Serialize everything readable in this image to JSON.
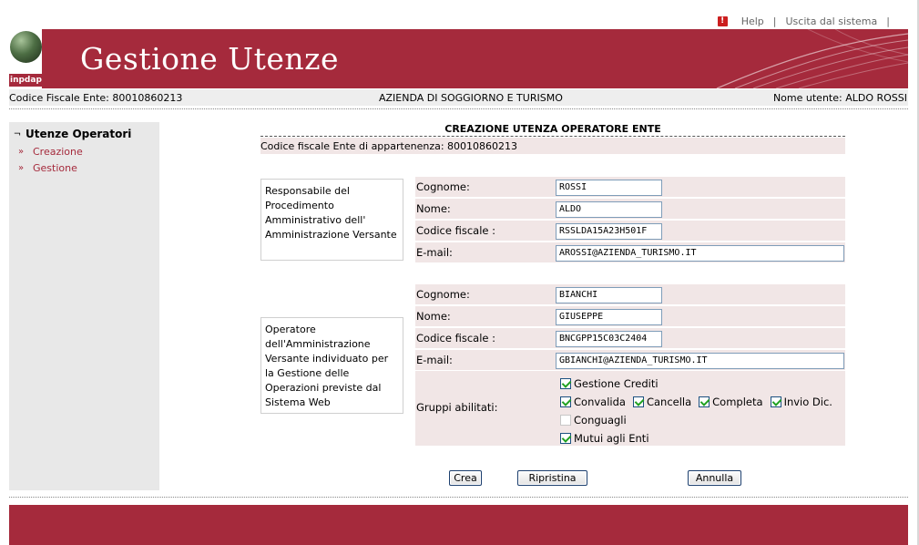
{
  "header": {
    "help_label": "Help",
    "exit_label": "Uscita dal sistema",
    "separator": "|",
    "help_icon": "!",
    "title": "Gestione Utenze",
    "logo_text": "inpdap",
    "brand_color": "#a52a3c"
  },
  "info_bar": {
    "codice_fiscale_ente": "Codice Fiscale Ente:  80010860213",
    "ente_name": "AZIENDA DI SOGGIORNO E TURISMO",
    "user": "Nome utente: ALDO ROSSI"
  },
  "sidebar": {
    "title": "Utenze Operatori",
    "title_bullet": "¬",
    "item_bullet": "»",
    "items": [
      {
        "label": "Creazione"
      },
      {
        "label": "Gestione"
      }
    ]
  },
  "form": {
    "title": "CREAZIONE UTENZA OPERATORE ENTE",
    "ente_row": "Codice fiscale Ente di appartenenza: 80010860213",
    "responsabile": {
      "description": "Responsabile del Procedimento Amministrativo dell' Amministrazione Versante",
      "cognome_label": "Cognome:",
      "cognome_value": "ROSSI",
      "nome_label": "Nome:",
      "nome_value": "ALDO",
      "cf_label": "Codice fiscale :",
      "cf_value": "RSSLDA15A23H501F",
      "email_label": "E-mail:",
      "email_value": "AROSSI@AZIENDA_TURISMO.IT"
    },
    "operatore": {
      "description": "Operatore dell'Amministrazione Versante individuato per la Gestione delle Operazioni previste dal Sistema Web",
      "cognome_label": "Cognome:",
      "cognome_value": "BIANCHI",
      "nome_label": "Nome:",
      "nome_value": "GIUSEPPE",
      "cf_label": "Codice fiscale :",
      "cf_value": "BNCGPP15C03C2404",
      "email_label": "E-mail:",
      "email_value": "GBIANCHI@AZIENDA_TURISMO.IT"
    },
    "gruppi": {
      "label": "Gruppi abilitati:",
      "gestione_crediti": {
        "label": "Gestione Crediti",
        "checked": true
      },
      "convalida": {
        "label": "Convalida",
        "checked": true
      },
      "cancella": {
        "label": "Cancella",
        "checked": true
      },
      "completa": {
        "label": "Completa",
        "checked": true
      },
      "invio_dic": {
        "label": "Invio Dic.",
        "checked": true
      },
      "conguagli": {
        "label": "Conguagli",
        "checked": false
      },
      "mutui": {
        "label": "Mutui agli Enti",
        "checked": true
      }
    }
  },
  "buttons": {
    "crea": "Crea",
    "ripristina": "Ripristina",
    "annulla": "Annulla"
  }
}
